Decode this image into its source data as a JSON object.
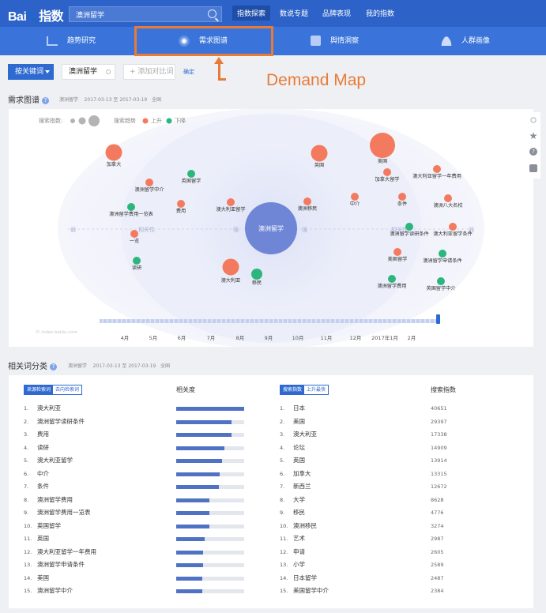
{
  "header": {
    "logo_text": "Bai",
    "logo_suffix": "指数",
    "search_value": "澳洲留学",
    "nav": [
      {
        "label": "指数探索",
        "active": true
      },
      {
        "label": "数说专题",
        "active": false
      },
      {
        "label": "品牌表现",
        "active": false
      },
      {
        "label": "我的指数",
        "active": false
      }
    ]
  },
  "subnav": [
    {
      "label": "趋势研究",
      "icon": "trend-chart-icon"
    },
    {
      "label": "需求图谱",
      "icon": "demand-map-icon"
    },
    {
      "label": "舆情洞察",
      "icon": "news-icon"
    },
    {
      "label": "人群画像",
      "icon": "crowd-icon"
    }
  ],
  "annotation": {
    "label": "Demand Map",
    "color": "#e97b36"
  },
  "controls": {
    "keyword_select": "按关键词",
    "keyword_chip": "澳洲留学",
    "add_compare": "+ 添加对比词",
    "confirm": "确定"
  },
  "demand_map": {
    "title": "需求图谱",
    "keyword": "澳洲留学",
    "date_range": "2017-03-13 至 2017-03-19",
    "region": "全国",
    "legend": {
      "search_index_label": "搜索指数:",
      "trend_label": "搜索趋势",
      "up_label": "上升",
      "down_label": "下降"
    },
    "colors": {
      "up": "#f47a5f",
      "down": "#2cb67d",
      "center": "#6f86d6"
    },
    "center_word": "澳洲留学",
    "axis_labels": {
      "outer_left": "弱",
      "mid_left": "相关性",
      "inner_left": "强",
      "inner_right": "强",
      "mid_right": "相关性",
      "outer_right": "弱"
    },
    "watermark": "© index.baidu.com",
    "timeline_ticks": [
      "4月",
      "5月",
      "6月",
      "7月",
      "8月",
      "9月",
      "10月",
      "11月",
      "12月",
      "2017年1月",
      "2月"
    ],
    "bubbles": [
      {
        "word": "加拿大",
        "trend": "up",
        "size": "large"
      },
      {
        "word": "澳洲留学中介",
        "trend": "up",
        "size": "small"
      },
      {
        "word": "英国留学",
        "trend": "down",
        "size": "small"
      },
      {
        "word": "澳洲留学费用一览表",
        "trend": "down",
        "size": "small"
      },
      {
        "word": "费用",
        "trend": "up",
        "size": "small"
      },
      {
        "word": "一览",
        "trend": "up",
        "size": "small"
      },
      {
        "word": "读研",
        "trend": "down",
        "size": "small"
      },
      {
        "word": "澳大利亚留学",
        "trend": "up",
        "size": "small"
      },
      {
        "word": "澳大利亚",
        "trend": "up",
        "size": "large"
      },
      {
        "word": "移民",
        "trend": "down",
        "size": "medium"
      },
      {
        "word": "澳洲移民",
        "trend": "up",
        "size": "small"
      },
      {
        "word": "英国",
        "trend": "up",
        "size": "large"
      },
      {
        "word": "美国",
        "trend": "up",
        "size": "xlarge"
      },
      {
        "word": "加拿大留学",
        "trend": "up",
        "size": "small"
      },
      {
        "word": "中介",
        "trend": "up",
        "size": "small"
      },
      {
        "word": "条件",
        "trend": "up",
        "size": "small"
      },
      {
        "word": "澳大利亚留学一年费用",
        "trend": "up",
        "size": "small"
      },
      {
        "word": "澳洲八大名校",
        "trend": "up",
        "size": "small"
      },
      {
        "word": "澳洲留学读研条件",
        "trend": "down",
        "size": "small"
      },
      {
        "word": "澳大利亚留学条件",
        "trend": "up",
        "size": "small"
      },
      {
        "word": "美国留学",
        "trend": "up",
        "size": "small"
      },
      {
        "word": "澳洲留学申请条件",
        "trend": "down",
        "size": "small"
      },
      {
        "word": "澳洲留学费用",
        "trend": "down",
        "size": "small"
      },
      {
        "word": "英国留学中介",
        "trend": "down",
        "size": "small"
      }
    ]
  },
  "related": {
    "title": "相关词分类",
    "keyword": "澳洲留学",
    "date_range": "2017-03-13 至 2017-03-19",
    "region": "全国",
    "left_tabs": [
      "来源检索词",
      "去向检索词"
    ],
    "left_metric_label": "相关度",
    "right_tabs": [
      "搜索指数",
      "上升最快"
    ],
    "right_metric_label": "搜索指数",
    "left_rows": [
      {
        "rank": "1.",
        "word": "澳大利亚",
        "relevance": 1.0
      },
      {
        "rank": "2.",
        "word": "澳洲留学读研条件",
        "relevance": 0.81
      },
      {
        "rank": "3.",
        "word": "费用",
        "relevance": 0.81
      },
      {
        "rank": "4.",
        "word": "读研",
        "relevance": 0.71
      },
      {
        "rank": "5.",
        "word": "澳大利亚留学",
        "relevance": 0.67
      },
      {
        "rank": "6.",
        "word": "中介",
        "relevance": 0.64
      },
      {
        "rank": "7.",
        "word": "条件",
        "relevance": 0.63
      },
      {
        "rank": "8.",
        "word": "澳洲留学费用",
        "relevance": 0.49
      },
      {
        "rank": "9.",
        "word": "澳洲留学费用一览表",
        "relevance": 0.49
      },
      {
        "rank": "10.",
        "word": "英国留学",
        "relevance": 0.49
      },
      {
        "rank": "11.",
        "word": "英国",
        "relevance": 0.42
      },
      {
        "rank": "12.",
        "word": "澳大利亚留学一年费用",
        "relevance": 0.4
      },
      {
        "rank": "13.",
        "word": "澳洲留学申请条件",
        "relevance": 0.4
      },
      {
        "rank": "14.",
        "word": "美国",
        "relevance": 0.38
      },
      {
        "rank": "15.",
        "word": "澳洲留学中介",
        "relevance": 0.38
      }
    ],
    "right_rows": [
      {
        "rank": "1.",
        "word": "日本",
        "index": "40651"
      },
      {
        "rank": "2.",
        "word": "美国",
        "index": "29397"
      },
      {
        "rank": "3.",
        "word": "澳大利亚",
        "index": "17338"
      },
      {
        "rank": "4.",
        "word": "论坛",
        "index": "14909"
      },
      {
        "rank": "5.",
        "word": "英国",
        "index": "13914"
      },
      {
        "rank": "6.",
        "word": "加拿大",
        "index": "13315"
      },
      {
        "rank": "7.",
        "word": "新西兰",
        "index": "12672"
      },
      {
        "rank": "8.",
        "word": "大学",
        "index": "8628"
      },
      {
        "rank": "9.",
        "word": "移民",
        "index": "4776"
      },
      {
        "rank": "10.",
        "word": "澳洲移民",
        "index": "3274"
      },
      {
        "rank": "11.",
        "word": "艺术",
        "index": "2987"
      },
      {
        "rank": "12.",
        "word": "申请",
        "index": "2605"
      },
      {
        "rank": "13.",
        "word": "小学",
        "index": "2589"
      },
      {
        "rank": "14.",
        "word": "日本留学",
        "index": "2487"
      },
      {
        "rank": "15.",
        "word": "美国留学中介",
        "index": "2384"
      }
    ]
  }
}
